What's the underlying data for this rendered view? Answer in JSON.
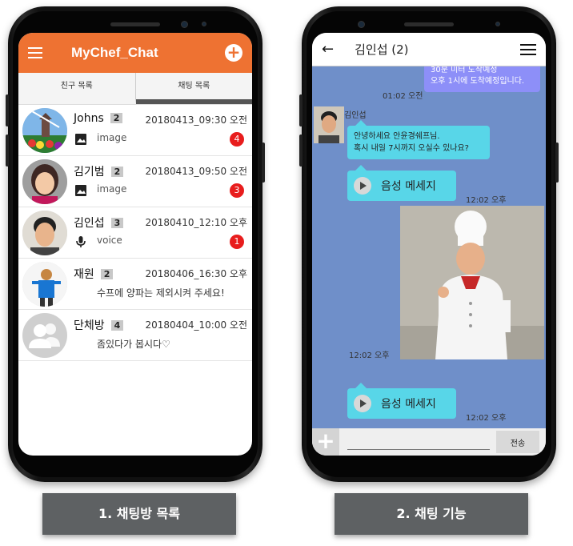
{
  "screen1": {
    "app_title": "MyChef_Chat",
    "tabs": [
      "친구 목록",
      "채팅 목록"
    ],
    "active_tab": "채팅 목록",
    "rooms": [
      {
        "name": "Johns",
        "count": "2",
        "time": "20180413_09:30 오전",
        "type": "image",
        "message": "image",
        "unread": "4"
      },
      {
        "name": "김기범",
        "count": "2",
        "time": "20180413_09:50 오전",
        "type": "image",
        "message": "image",
        "unread": "3"
      },
      {
        "name": "김인섭",
        "count": "3",
        "time": "20180410_12:10 오후",
        "type": "voice",
        "message": "voice",
        "unread": "1"
      },
      {
        "name": "재원",
        "count": "2",
        "time": "20180406_16:30 오후",
        "type": "text",
        "message": "수프에 양파는 제외시켜 주세요!",
        "unread": ""
      },
      {
        "name": "단체방",
        "count": "4",
        "time": "20180404_10:00 오전",
        "type": "text",
        "message": "좀있다가 봅시다♡",
        "unread": ""
      }
    ]
  },
  "screen2": {
    "chat_title": "김인섭 (2)",
    "my_message": "30분 미터 도착예정\n오후 1시에 도착예정입니다.",
    "my_message_time": "01:02 오전",
    "sender_name": "김인섭",
    "incoming_text": "안녕하세요 안윤경쉐프님.\n혹시 내일 7시까지 오실수 있나요?",
    "voice_label": "음성 메세지",
    "voice_time_1": "12:02 오후",
    "photo_time": "12:02 오후",
    "voice_time_2": "12:02 오후",
    "input_placeholder": "",
    "send_label": "전송"
  },
  "captions": [
    "1. 채팅방 목록",
    "2. 채팅 기능"
  ],
  "colors": {
    "appbar": "#ee7232",
    "chat_bg": "#6f8fc9",
    "bubble_in": "#58d6e8",
    "bubble_mine": "#8d8ff8",
    "badge": "#e81d1d",
    "caption_bg": "#5e6163"
  }
}
